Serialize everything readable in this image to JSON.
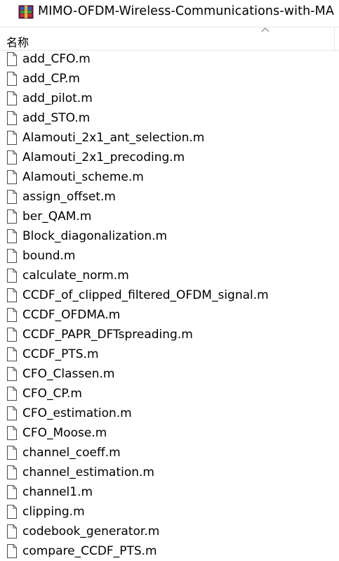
{
  "window": {
    "title": "MIMO-OFDM-Wireless-Communications-with-MA",
    "icon": "winrar-archive-icon"
  },
  "column_header": {
    "name_label": "名称",
    "sort_icon": "chevron-up-icon"
  },
  "files": [
    {
      "name": "add_CFO.m"
    },
    {
      "name": "add_CP.m"
    },
    {
      "name": "add_pilot.m"
    },
    {
      "name": "add_STO.m"
    },
    {
      "name": "Alamouti_2x1_ant_selection.m"
    },
    {
      "name": "Alamouti_2x1_precoding.m"
    },
    {
      "name": "Alamouti_scheme.m"
    },
    {
      "name": "assign_offset.m"
    },
    {
      "name": "ber_QAM.m"
    },
    {
      "name": "Block_diagonalization.m"
    },
    {
      "name": "bound.m"
    },
    {
      "name": "calculate_norm.m"
    },
    {
      "name": "CCDF_of_clipped_filtered_OFDM_signal.m"
    },
    {
      "name": "CCDF_OFDMA.m"
    },
    {
      "name": "CCDF_PAPR_DFTspreading.m"
    },
    {
      "name": "CCDF_PTS.m"
    },
    {
      "name": "CFO_Classen.m"
    },
    {
      "name": "CFO_CP.m"
    },
    {
      "name": "CFO_estimation.m"
    },
    {
      "name": "CFO_Moose.m"
    },
    {
      "name": "channel_coeff.m"
    },
    {
      "name": "channel_estimation.m"
    },
    {
      "name": "channel1.m"
    },
    {
      "name": "clipping.m"
    },
    {
      "name": "codebook_generator.m"
    },
    {
      "name": "compare_CCDF_PTS.m"
    }
  ]
}
